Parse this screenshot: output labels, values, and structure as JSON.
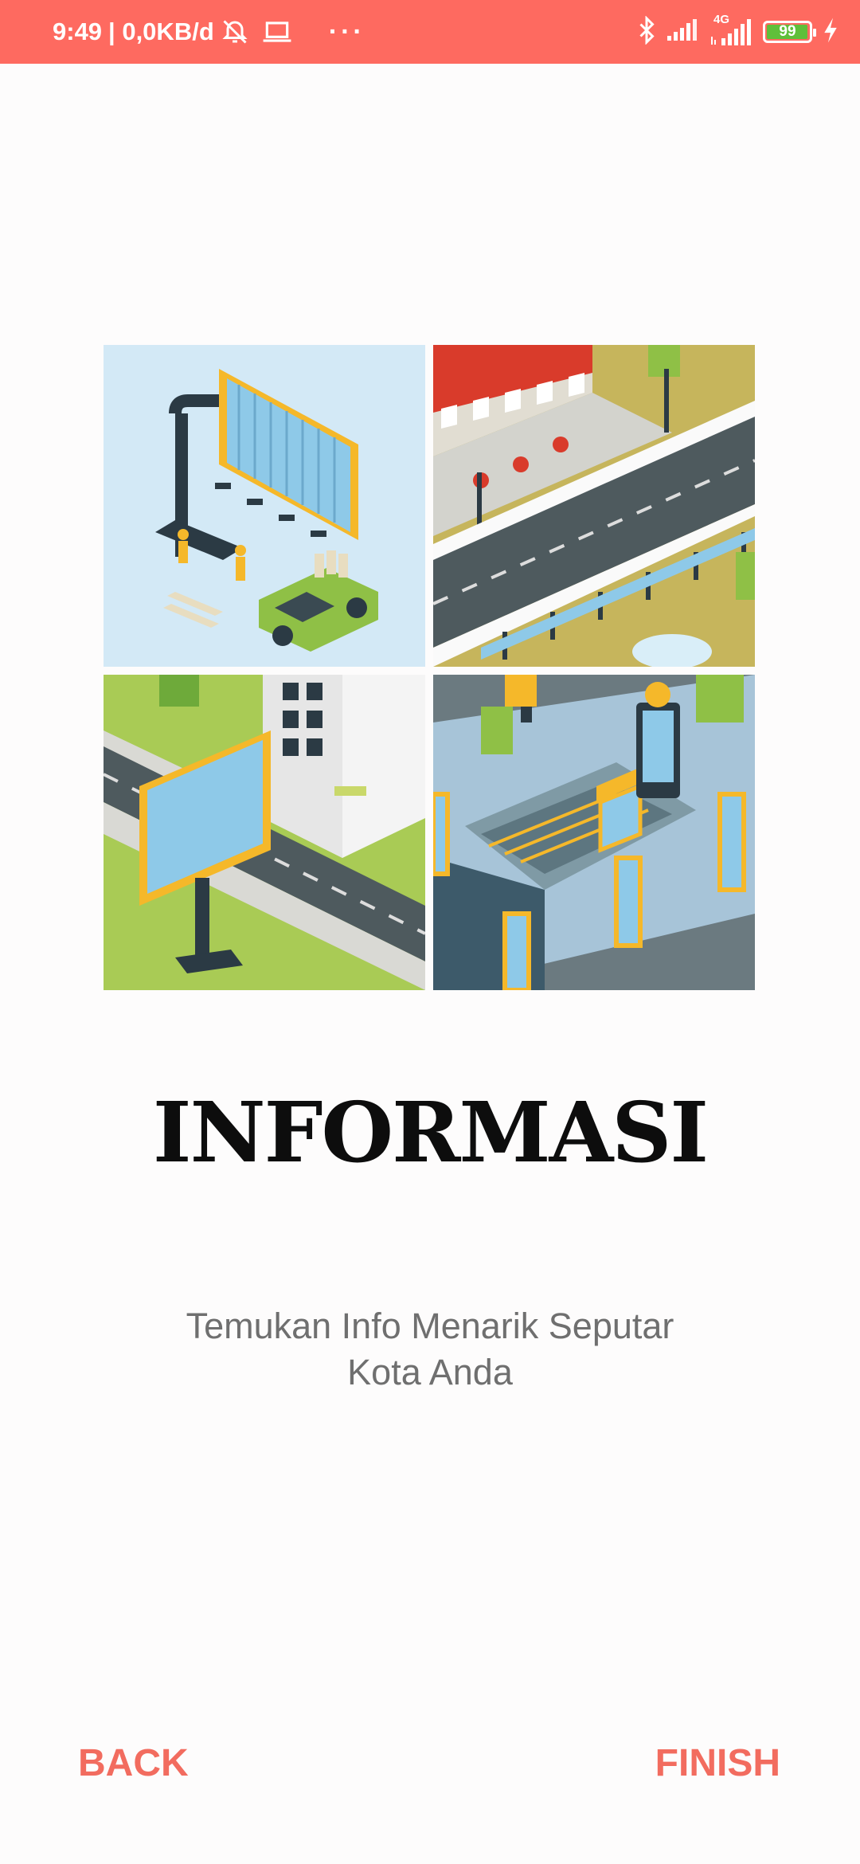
{
  "status_bar": {
    "time": "9:49",
    "speed": "| 0,0KB/d",
    "more": "···",
    "network_type": "4G",
    "battery_level": "99",
    "colors": {
      "background": "#fe6a60",
      "battery_fill": "#5fbf3a"
    },
    "icons": [
      "alarm-off-icon",
      "laptop-icon",
      "bluetooth-icon",
      "signal-icon",
      "signal-4g-icon",
      "battery-icon",
      "charging-icon"
    ]
  },
  "onboarding": {
    "illustration_icon": "city-billboards-illustration",
    "title": "INFORMASI",
    "subtitle_line1": "Temukan Info Menarik Seputar",
    "subtitle_line2": "Kota Anda"
  },
  "navigation": {
    "back_label": "BACK",
    "finish_label": "FINISH",
    "accent_color": "#f26c5f"
  }
}
